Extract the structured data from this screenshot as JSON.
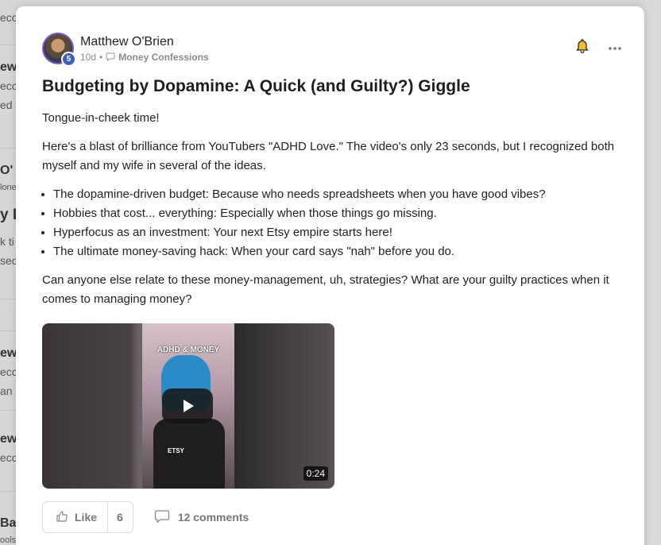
{
  "background": {
    "snippets": [
      "ecc",
      "ew C",
      "ecc",
      "ed f",
      "O'",
      "lone",
      "y D",
      "k ti",
      "sec",
      "ew C",
      "ecc",
      "an",
      "ew C",
      "ecc",
      "Ba",
      "ools"
    ]
  },
  "post": {
    "author": "Matthew O'Brien",
    "level": "5",
    "time": "10d",
    "separator": "•",
    "category": "Money Confessions",
    "title": "Budgeting by Dopamine: A Quick (and Guilty?) Giggle",
    "intro": "Tongue-in-cheek time!",
    "paragraph1": "Here's a blast of brilliance from YouTubers \"ADHD Love.\" The video's only 23 seconds, but I recognized both myself and my wife in several of the ideas.",
    "bullets": [
      "The dopamine-driven budget: Because who needs spreadsheets when you have good vibes?",
      "Hobbies that cost... everything: Especially when those things go missing.",
      "Hyperfocus as an investment: Your next Etsy empire starts here!",
      "The ultimate money-saving hack: When your card says \"nah\" before you do."
    ],
    "paragraph2": "Can anyone else relate to these money-management, uh, strategies? What are your guilty practices when it comes to managing money?",
    "video": {
      "overlay_text": "ADHD & MONEY",
      "sticker_text": "ETSY",
      "duration": "0:24"
    },
    "like_label": "Like",
    "like_count": "6",
    "comments_label": "12 comments"
  }
}
